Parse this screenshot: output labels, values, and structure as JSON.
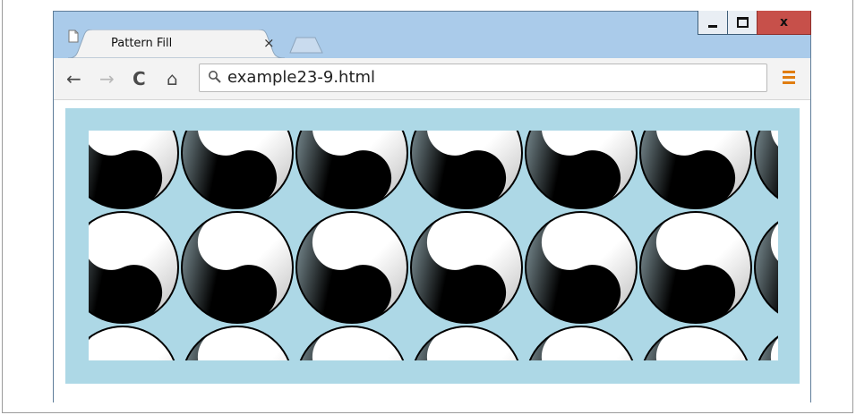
{
  "window": {
    "tab_title": "Pattern Fill",
    "tab_close_glyph": "×",
    "address": "example23-9.html",
    "controls": {
      "minimize": "minimize",
      "maximize": "maximize",
      "close": "x"
    },
    "nav_glyphs": {
      "back": "←",
      "forward": "→",
      "reload": "C",
      "home": "⌂"
    },
    "icons": [
      "page-favicon-icon",
      "search-icon",
      "menu-icon",
      "yin-yang-icon"
    ]
  },
  "content": {
    "background_color": "#add8e6",
    "pattern": "yin-yang"
  }
}
